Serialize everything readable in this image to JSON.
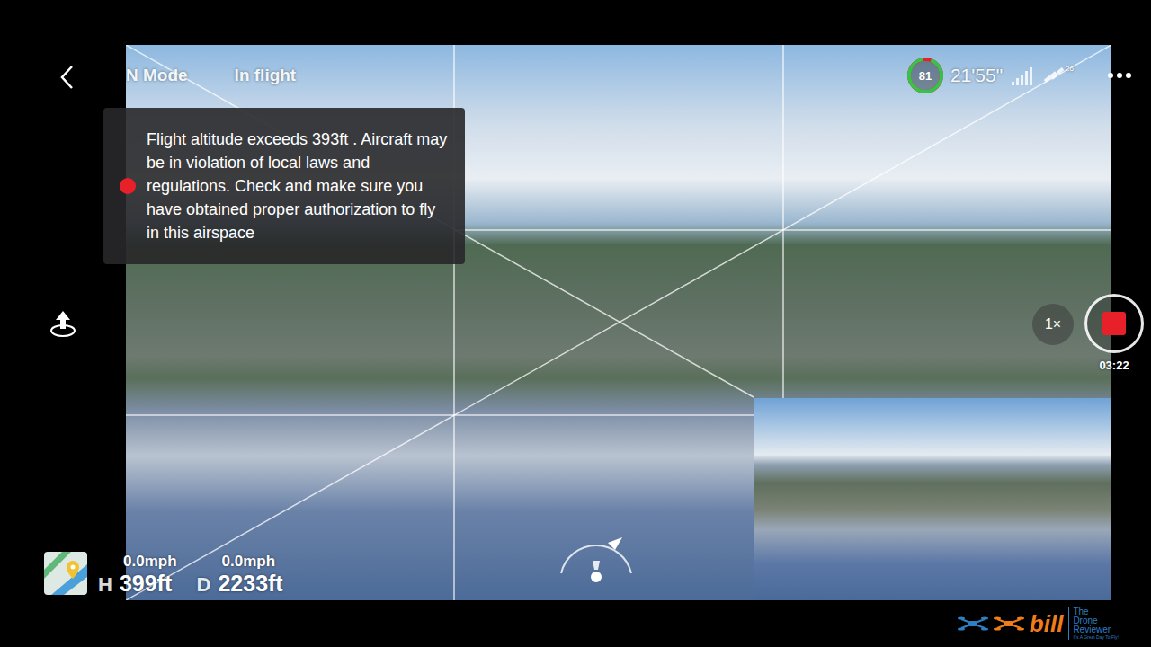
{
  "header": {
    "mode": "N Mode",
    "status": "In flight"
  },
  "warning": {
    "text": "Flight altitude exceeds 393ft . Aircraft may be in violation of local laws and regulations. Check and make sure you have obtained proper authorization to fly in this airspace",
    "color": "#e8202a"
  },
  "battery": {
    "percent": "81",
    "level": 0.92
  },
  "flight_time": "21'55\"",
  "satellites": "26",
  "zoom": "1×",
  "recording": {
    "on": true,
    "time": "03:22"
  },
  "telemetry": [
    {
      "speed": "0.0mph",
      "label": "H",
      "value": "399ft"
    },
    {
      "speed": "0.0mph",
      "label": "D",
      "value": "2233ft"
    }
  ],
  "watermark": {
    "name": "bill",
    "line1": "The",
    "line2": "Drone",
    "line3": "Reviewer",
    "tagline": "It's A Great Day To Fly!"
  }
}
